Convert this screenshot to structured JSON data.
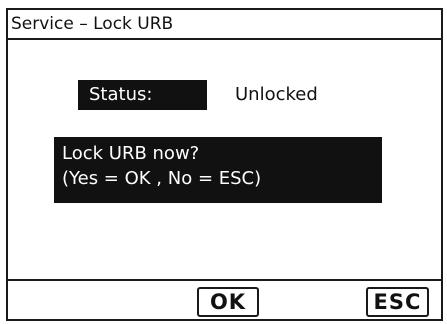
{
  "window": {
    "title": "Service – Lock URB"
  },
  "status": {
    "label": "Status:",
    "value": "Unlocked"
  },
  "prompt": {
    "line1": "Lock URB now?",
    "line2": "(Yes = OK , No = ESC)"
  },
  "softkeys": {
    "ok_label": "OK",
    "esc_label": "ESC"
  },
  "colors": {
    "background": "#ffffff",
    "foreground": "#111111",
    "highlight_background": "#111111",
    "highlight_text": "#ffffff"
  }
}
